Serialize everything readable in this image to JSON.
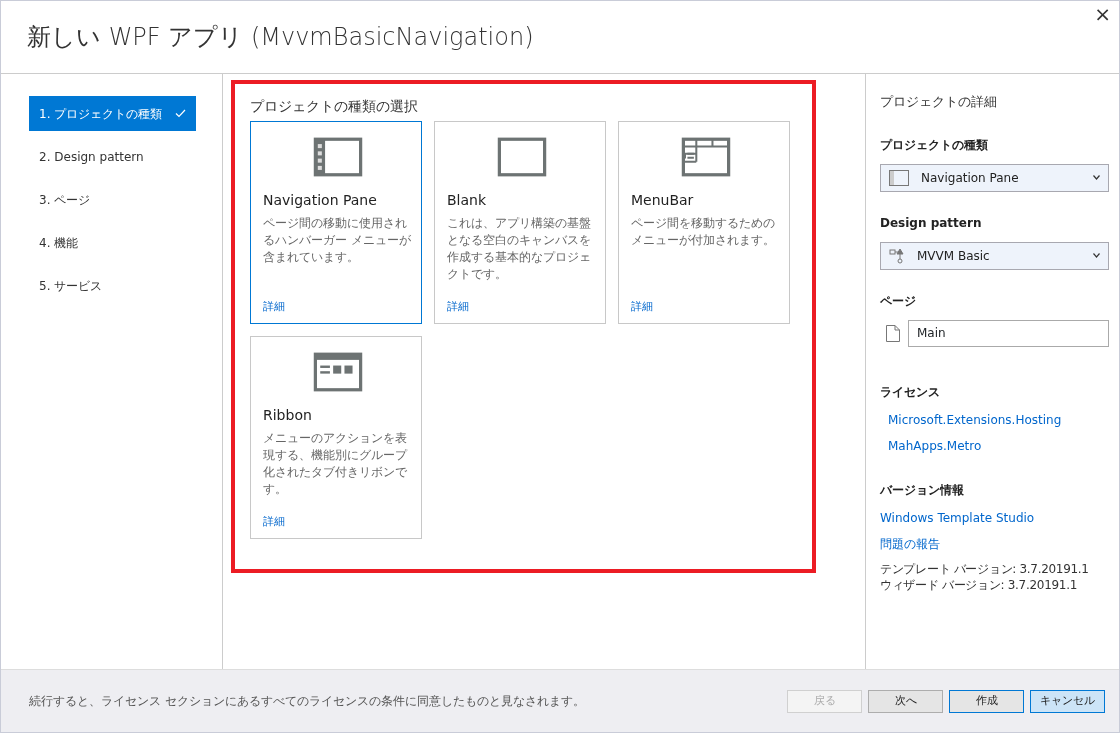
{
  "window": {
    "title": "新しい WPF アプリ (MvvmBasicNavigation)",
    "close": "×"
  },
  "steps": [
    {
      "label": "1. プロジェクトの種類",
      "selected": true,
      "done": true
    },
    {
      "label": "2. Design pattern",
      "selected": false,
      "done": false
    },
    {
      "label": "3. ページ",
      "selected": false,
      "done": false
    },
    {
      "label": "4. 機能",
      "selected": false,
      "done": false
    },
    {
      "label": "5. サービス",
      "selected": false,
      "done": false
    }
  ],
  "project_types": {
    "heading": "プロジェクトの種類の選択",
    "highlighted": true,
    "cards": [
      {
        "kind": "navpane",
        "title": "Navigation Pane",
        "description": "ページ間の移動に使用されるハンバーガー メニューが含まれています。",
        "link": "詳細",
        "selected": true
      },
      {
        "kind": "blank",
        "title": "Blank",
        "description": "これは、アプリ構築の基盤となる空白のキャンバスを作成する基本的なプロジェクトです。",
        "link": "詳細",
        "selected": false
      },
      {
        "kind": "menubar",
        "title": "MenuBar",
        "description": "ページ間を移動するためのメニューが付加されます。",
        "link": "詳細",
        "selected": false
      },
      {
        "kind": "ribbon",
        "title": "Ribbon",
        "description": "メニューのアクションを表現する、機能別にグループ化されたタブ付きリボンです。",
        "link": "詳細",
        "selected": false
      }
    ]
  },
  "details": {
    "heading": "プロジェクトの詳細",
    "project_type": {
      "label": "プロジェクトの種類",
      "value": "Navigation Pane"
    },
    "design_pattern": {
      "label": "Design pattern",
      "value": "MVVM Basic"
    },
    "pages": {
      "label": "ページ",
      "value": "Main"
    },
    "licenses": {
      "label": "ライセンス",
      "links": [
        "Microsoft.Extensions.Hosting",
        "MahApps.Metro"
      ]
    },
    "version": {
      "label": "バージョン情報",
      "links": [
        "Windows Template Studio",
        "問題の報告"
      ],
      "lines": [
        "テンプレート バージョン: 3.7.20191.1",
        "ウィザード バージョン: 3.7.20191.1"
      ]
    }
  },
  "footer": {
    "notice": "続行すると、ライセンス セクションにあるすべてのライセンスの条件に同意したものと見なされます。",
    "buttons": [
      {
        "label": "戻る",
        "disabled": true,
        "default": false,
        "focused": false
      },
      {
        "label": "次へ",
        "disabled": false,
        "default": false,
        "focused": false
      },
      {
        "label": "作成",
        "disabled": false,
        "default": true,
        "focused": false
      },
      {
        "label": "キャンセル",
        "disabled": false,
        "default": false,
        "focused": true
      }
    ]
  }
}
